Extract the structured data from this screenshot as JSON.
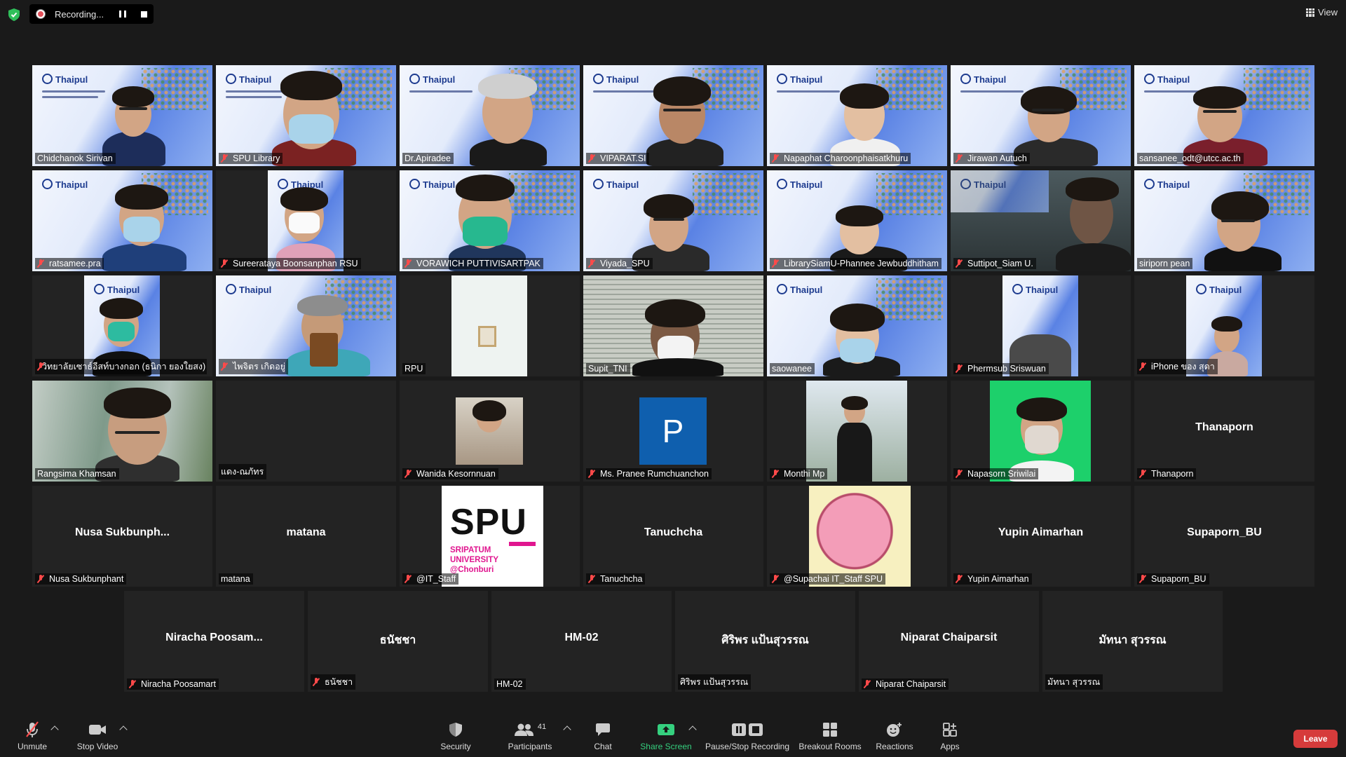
{
  "recording": {
    "label": "Recording..."
  },
  "view": {
    "label": "View"
  },
  "gallery": {
    "row1": [
      {
        "name": "Chidchanok Sirivan",
        "muted": false
      },
      {
        "name": "SPU Library",
        "muted": true
      },
      {
        "name": "Dr.Apiradee",
        "muted": false
      },
      {
        "name": "VIPARAT.SI",
        "muted": true
      },
      {
        "name": "Napaphat Charoonphaisatkhuru",
        "muted": true
      },
      {
        "name": "Jirawan Autuch",
        "muted": true
      },
      {
        "name": "sansanee_odt@utcc.ac.th",
        "muted": false
      }
    ],
    "row2": [
      {
        "name": "ratsamee.pra",
        "muted": true
      },
      {
        "name": "Sureerataya Boonsanphan RSU",
        "muted": true
      },
      {
        "name": "VORAWICH PUTTIVISARTPAK",
        "muted": true
      },
      {
        "name": "Viyada_SPU",
        "muted": true
      },
      {
        "name": "LibrarySiamU-Phannee Jewbuddhitham",
        "muted": true
      },
      {
        "name": "Suttipot_Siam U.",
        "muted": true
      },
      {
        "name": "siriporn pean",
        "muted": false
      }
    ],
    "row3": [
      {
        "name": "วิทยาลัยเซาธ์อีสท์บางกอก (ธนิกา ยองใยสง)",
        "muted": true
      },
      {
        "name": "ไพจิตร เกิดอยู่",
        "muted": true
      },
      {
        "name": "RPU",
        "muted": false
      },
      {
        "name": "Supit_TNI",
        "muted": false
      },
      {
        "name": "saowanee",
        "muted": false
      },
      {
        "name": "Phermsub Sriswuan",
        "muted": true
      },
      {
        "name": "iPhone ของ สุดา",
        "muted": true
      }
    ],
    "row4": [
      {
        "name": "Rangsima Khamsan",
        "muted": false
      },
      {
        "name": "แดง-ณภัทร",
        "muted": false
      },
      {
        "name": "Wanida Kesornnuan",
        "muted": true
      },
      {
        "name": "Ms. Pranee Rumchuanchon",
        "muted": true,
        "avatar": "P"
      },
      {
        "name": "Monthi Mp",
        "muted": true
      },
      {
        "name": "Napasorn Sriwilai",
        "muted": true
      },
      {
        "name": "Thanaporn",
        "muted": true,
        "display": "Thanaporn"
      }
    ],
    "row5": [
      {
        "name": "Nusa Sukbunphant",
        "muted": true,
        "display": "Nusa  Sukbunph..."
      },
      {
        "name": "matana",
        "muted": false,
        "display": "matana"
      },
      {
        "name": "@IT_Staff",
        "muted": true
      },
      {
        "name": "Tanuchcha",
        "muted": true,
        "display": "Tanuchcha"
      },
      {
        "name": "@Supachai IT_Staff SPU",
        "muted": true
      },
      {
        "name": "Yupin Aimarhan",
        "muted": true,
        "display": "Yupin Aimarhan"
      },
      {
        "name": "Supaporn_BU",
        "muted": true,
        "display": "Supaporn_BU"
      }
    ],
    "row6": [
      {
        "name": "Niracha Poosamart",
        "muted": true,
        "display": "Niracha  Poosam..."
      },
      {
        "name": "ธนัชชา",
        "muted": true,
        "display": "ธนัชชา"
      },
      {
        "name": "HM-02",
        "muted": false,
        "display": "HM-02"
      },
      {
        "name": "ศิริพร แป้นสุวรรณ",
        "muted": false,
        "display": "ศิริพร แป้นสุวรรณ"
      },
      {
        "name": "Niparat Chaiparsit",
        "muted": true,
        "display": "Niparat Chaiparsit"
      },
      {
        "name": "มัทนา สุวรรณ",
        "muted": false,
        "display": "มัทนา สุวรรณ"
      }
    ],
    "spu_logo": {
      "big": "SPU",
      "line1": "SRIPATUM",
      "line2": "UNIVERSITY",
      "line3": "@Chonburi"
    },
    "poster_title": "Thaipul"
  },
  "toolbar": {
    "unmute": "Unmute",
    "stop_video": "Stop Video",
    "security": "Security",
    "participants": "Participants",
    "participants_count": "41",
    "chat": "Chat",
    "share_screen": "Share Screen",
    "pause_stop_recording": "Pause/Stop Recording",
    "breakout_rooms": "Breakout Rooms",
    "reactions": "Reactions",
    "apps": "Apps",
    "leave": "Leave"
  },
  "colors": {
    "active_speaker": "#e8e57a",
    "share_green": "#35d07f",
    "leave_red": "#d63b3b",
    "muted_red": "#ff4a4a"
  }
}
